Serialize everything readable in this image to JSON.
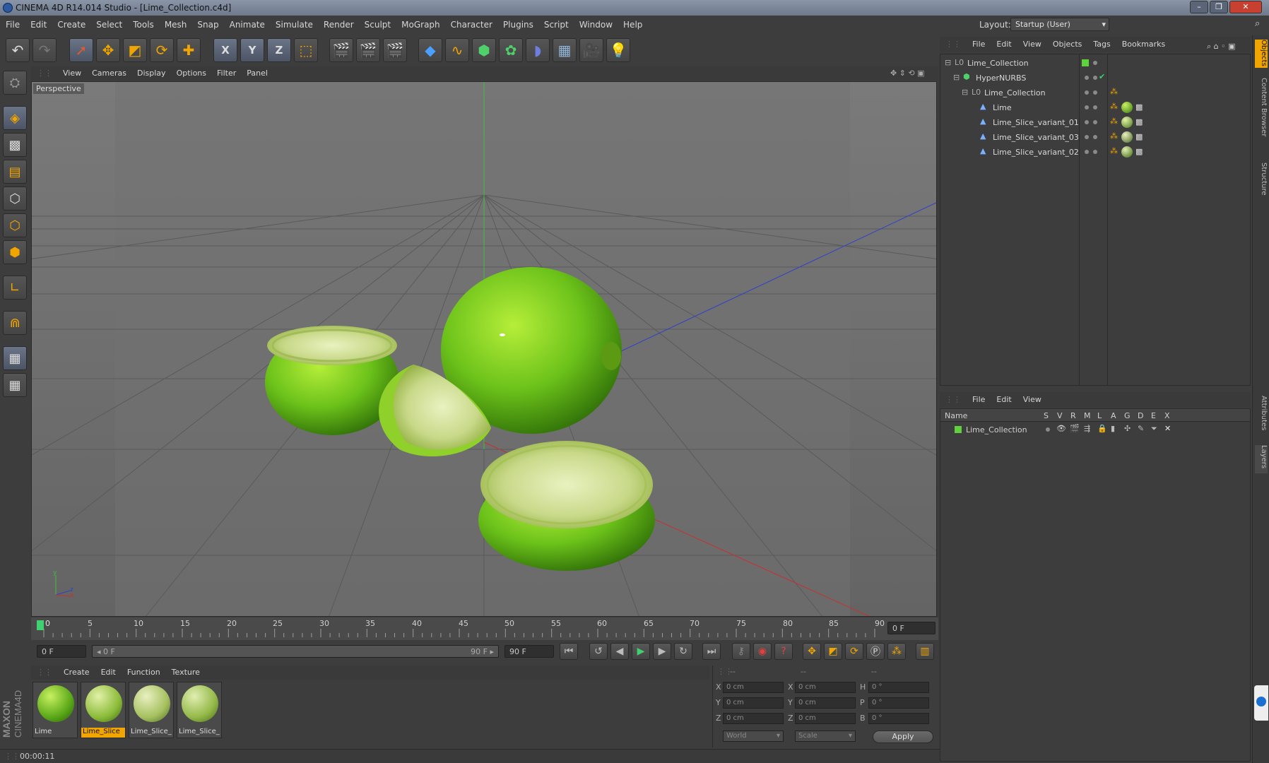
{
  "window": {
    "title": "CINEMA 4D R14.014 Studio - [Lime_Collection.c4d]",
    "buttons": [
      "–",
      "❐",
      "✕"
    ]
  },
  "menu": [
    "File",
    "Edit",
    "Create",
    "Select",
    "Tools",
    "Mesh",
    "Snap",
    "Animate",
    "Simulate",
    "Render",
    "Sculpt",
    "MoGraph",
    "Character",
    "Plugins",
    "Script",
    "Window",
    "Help"
  ],
  "layout": {
    "label": "Layout:",
    "value": "Startup (User)"
  },
  "axis_buttons": [
    "X",
    "Y",
    "Z"
  ],
  "viewport": {
    "menu": [
      "View",
      "Cameras",
      "Display",
      "Options",
      "Filter",
      "Panel"
    ],
    "label": "Perspective",
    "axis_labels": [
      "y",
      "z",
      "x"
    ]
  },
  "timeline": {
    "ticks": [
      "0",
      "5",
      "10",
      "15",
      "20",
      "25",
      "30",
      "35",
      "40",
      "45",
      "50",
      "55",
      "60",
      "65",
      "70",
      "75",
      "80",
      "85",
      "90"
    ],
    "current_frame": "0 F",
    "start_field": "0 F",
    "range_start": "◂ 0 F",
    "range_end": "90 F ▸",
    "end_field": "90 F"
  },
  "materials": {
    "menu": [
      "Create",
      "Edit",
      "Function",
      "Texture"
    ],
    "items": [
      {
        "label": "Lime",
        "selected": false
      },
      {
        "label": "Lime_Slice",
        "selected": true
      },
      {
        "label": "Lime_Slice_",
        "selected": false
      },
      {
        "label": "Lime_Slice_",
        "selected": false
      }
    ]
  },
  "coordinates": {
    "headers": [
      "--",
      "--",
      "--"
    ],
    "rows": [
      {
        "k1": "X",
        "v1": "0 cm",
        "k2": "X",
        "v2": "0 cm",
        "k3": "H",
        "v3": "0 °"
      },
      {
        "k1": "Y",
        "v1": "0 cm",
        "k2": "Y",
        "v2": "0 cm",
        "k3": "P",
        "v3": "0 °"
      },
      {
        "k1": "Z",
        "v1": "0 cm",
        "k2": "Z",
        "v2": "0 cm",
        "k3": "B",
        "v3": "0 °"
      }
    ],
    "world": "World",
    "scale": "Scale",
    "apply": "Apply"
  },
  "status": {
    "time": "00:00:11"
  },
  "objects": {
    "menu": [
      "File",
      "Edit",
      "View",
      "Objects",
      "Tags",
      "Bookmarks"
    ],
    "tree": [
      {
        "name": "Lime_Collection",
        "depth": 0,
        "icon": "null-icon"
      },
      {
        "name": "HyperNURBS",
        "depth": 1,
        "icon": "hypernurbs-icon"
      },
      {
        "name": "Lime_Collection",
        "depth": 2,
        "icon": "null-icon"
      },
      {
        "name": "Lime",
        "depth": 3,
        "icon": "polygon-icon"
      },
      {
        "name": "Lime_Slice_variant_01",
        "depth": 3,
        "icon": "polygon-icon"
      },
      {
        "name": "Lime_Slice_variant_03",
        "depth": 3,
        "icon": "polygon-icon"
      },
      {
        "name": "Lime_Slice_variant_02",
        "depth": 3,
        "icon": "polygon-icon"
      }
    ]
  },
  "layers": {
    "menu": [
      "File",
      "Edit",
      "View"
    ],
    "columns": [
      "Name",
      "S",
      "V",
      "R",
      "M",
      "L",
      "A",
      "G",
      "D",
      "E",
      "X"
    ],
    "rows": [
      {
        "name": "Lime_Collection",
        "color": "#5fd13f"
      }
    ]
  },
  "side_tabs": [
    "Objects",
    "Content Browser",
    "Structure",
    "Attributes",
    "Layers"
  ],
  "brand": "MAXON CINEMA 4D"
}
